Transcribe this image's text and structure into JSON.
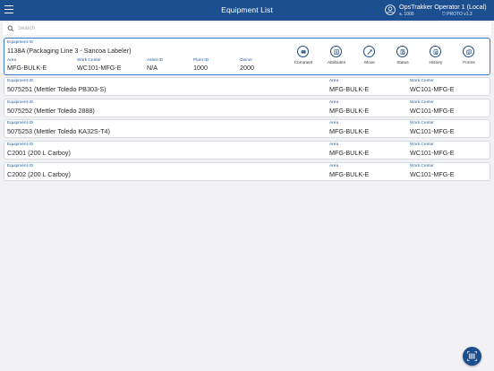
{
  "header": {
    "title": "Equipment List",
    "user_name": "OpsTrakker Operator 1 (Local)",
    "plant": "1000",
    "version": "PROTO v1.3"
  },
  "search": {
    "placeholder": "Search",
    "value": ""
  },
  "selected": {
    "equipment_id_label": "Equipment ID",
    "equipment_id": "1138A (Packaging Line 3 - Sancoa Labeler)",
    "area_label": "Area",
    "area": "MFG-BULK-E",
    "work_center_label": "Work Center",
    "work_center": "WC101-MFG-E",
    "asset_id_label": "Asset ID",
    "asset_id": "N/A",
    "plant_id_label": "Plant ID",
    "plant_id": "1000",
    "owner_label": "Owner",
    "owner": "2000",
    "actions": [
      {
        "label": "Comment",
        "icon": "comment-icon"
      },
      {
        "label": "Attributes",
        "icon": "list-icon"
      },
      {
        "label": "Move",
        "icon": "move-icon"
      },
      {
        "label": "Status",
        "icon": "status-icon"
      },
      {
        "label": "History",
        "icon": "history-icon"
      },
      {
        "label": "Forms",
        "icon": "forms-icon"
      }
    ]
  },
  "list": {
    "equipment_id_label": "Equipment ID",
    "area_label": "Area",
    "work_center_label": "Work Center",
    "items": [
      {
        "equipment_id": "5075251 (Mettler Toledo PB303-S)",
        "area": "MFG-BULK-E",
        "work_center": "WC101-MFG-E"
      },
      {
        "equipment_id": "5075252 (Mettler Toledo 2888)",
        "area": "MFG-BULK-E",
        "work_center": "WC101-MFG-E"
      },
      {
        "equipment_id": "5075253 (Mettler Toledo KA32S-T4)",
        "area": "MFG-BULK-E",
        "work_center": "WC101-MFG-E"
      },
      {
        "equipment_id": "C2001 (200 L Carboy)",
        "area": "MFG-BULK-E",
        "work_center": "WC101-MFG-E"
      },
      {
        "equipment_id": "C2002 (200 L Carboy)",
        "area": "MFG-BULK-E",
        "work_center": "WC101-MFG-E"
      }
    ]
  },
  "fab": {
    "icon": "barcode-scan-icon"
  },
  "colors": {
    "header": "#1b4f8f",
    "label": "#2a5f9e",
    "background": "#f2f2f4",
    "selected_border": "#3d7cc9"
  }
}
